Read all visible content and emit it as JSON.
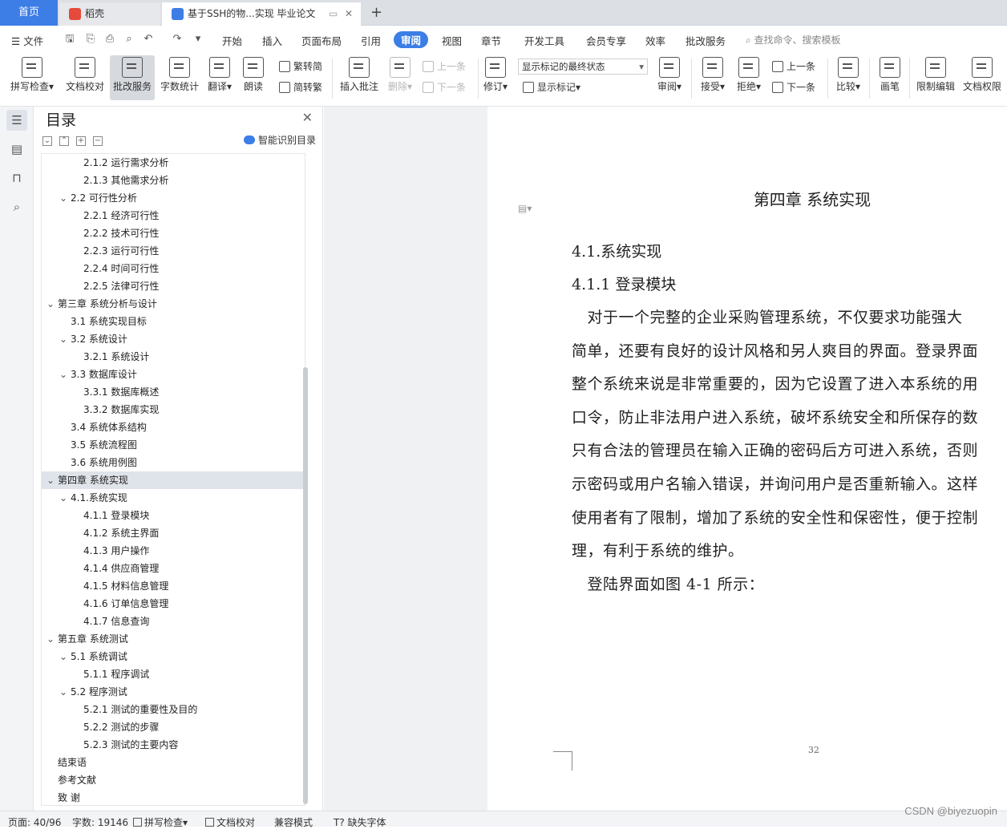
{
  "tabs": {
    "home": "首页",
    "docer": "稻壳",
    "doc": "基于SSH的物...实现 毕业论文",
    "add": "+"
  },
  "menu": {
    "file": "文件",
    "items": [
      "开始",
      "插入",
      "页面布局",
      "引用",
      "审阅",
      "视图",
      "章节",
      "开发工具",
      "会员专享",
      "效率",
      "批改服务"
    ],
    "active": "审阅",
    "search": "查找命令、搜索模板"
  },
  "ribbon": {
    "spell": "拼写检查",
    "proof": "文档校对",
    "correct": "批改服务",
    "wordcount": "字数统计",
    "translate": "翻译",
    "read": "朗读",
    "trad": "繁转简",
    "simp": "简转繁",
    "insert_comment": "插入批注",
    "delete": "删除",
    "prev": "上一条",
    "next": "下一条",
    "track": "修订",
    "markup_state": "显示标记的最终状态",
    "show_markup": "显示标记",
    "review": "审阅",
    "accept": "接受",
    "reject": "拒绝",
    "prev2": "上一条",
    "next2": "下一条",
    "compare": "比较",
    "pen": "画笔",
    "restrict": "限制编辑",
    "perm": "文档权限"
  },
  "nav": {
    "title": "目录",
    "smart": "智能识别目录",
    "toc": [
      {
        "text": "2.1.2 运行需求分析",
        "level": 3
      },
      {
        "text": "2.1.3 其他需求分析",
        "level": 3
      },
      {
        "text": "2.2 可行性分析",
        "level": 2,
        "arrow": true
      },
      {
        "text": "2.2.1 经济可行性",
        "level": 3
      },
      {
        "text": "2.2.2 技术可行性",
        "level": 3
      },
      {
        "text": "2.2.3  运行可行性",
        "level": 3
      },
      {
        "text": "2.2.4 时间可行性",
        "level": 3
      },
      {
        "text": "2.2.5  法律可行性",
        "level": 3
      },
      {
        "text": "第三章  系统分析与设计",
        "level": 1,
        "arrow": true
      },
      {
        "text": "3.1 系统实现目标",
        "level": 2
      },
      {
        "text": "3.2  系统设计",
        "level": 2,
        "arrow": true
      },
      {
        "text": "3.2.1 系统设计",
        "level": 3
      },
      {
        "text": "3.3 数据库设计",
        "level": 2,
        "arrow": true
      },
      {
        "text": "3.3.1 数据库概述",
        "level": 3
      },
      {
        "text": "3.3.2 数据库实现",
        "level": 3
      },
      {
        "text": "3.4 系统体系结构",
        "level": 2
      },
      {
        "text": "3.5 系统流程图",
        "level": 2
      },
      {
        "text": "3.6 系统用例图",
        "level": 2
      },
      {
        "text": "第四章  系统实现",
        "level": 1,
        "arrow": true,
        "selected": true
      },
      {
        "text": "4.1.系统实现",
        "level": 2,
        "arrow": true
      },
      {
        "text": "4.1.1  登录模块",
        "level": 3
      },
      {
        "text": "4.1.2 系统主界面",
        "level": 3
      },
      {
        "text": "4.1.3 用户操作",
        "level": 3
      },
      {
        "text": "4.1.4 供应商管理",
        "level": 3
      },
      {
        "text": "4.1.5 材料信息管理",
        "level": 3
      },
      {
        "text": "4.1.6 订单信息管理",
        "level": 3
      },
      {
        "text": "4.1.7 信息查询",
        "level": 3
      },
      {
        "text": "第五章    系统测试",
        "level": 1,
        "arrow": true
      },
      {
        "text": "5.1 系统调试",
        "level": 2,
        "arrow": true
      },
      {
        "text": "5.1.1  程序调试",
        "level": 3
      },
      {
        "text": "5.2  程序测试",
        "level": 2,
        "arrow": true
      },
      {
        "text": "5.2.1  测试的重要性及目的",
        "level": 3
      },
      {
        "text": "5.2.2  测试的步骤",
        "level": 3
      },
      {
        "text": "5.2.3  测试的主要内容",
        "level": 3
      },
      {
        "text": "结束语",
        "level": 1
      },
      {
        "text": "参考文献",
        "level": 1
      },
      {
        "text": "致    谢",
        "level": 1
      }
    ]
  },
  "doc": {
    "chapter": "第四章  系统实现",
    "h2a": "4.1.系统实现",
    "h2b": "4.1.1  登录模块",
    "lines": [
      "　对于一个完整的企业采购管理系统，不仅要求功能强大",
      "简单，还要有良好的设计风格和另人爽目的界面。登录界面",
      "整个系统来说是非常重要的，因为它设置了进入本系统的用",
      "口令，防止非法用户进入系统，破坏系统安全和所保存的数",
      "只有合法的管理员在输入正确的密码后方可进入系统，否则",
      "示密码或用户名输入错误，并询问用户是否重新输入。这样",
      "使用者有了限制，增加了系统的安全性和保密性，便于控制",
      "理，有利于系统的维护。",
      "　登陆界面如图 4-1 所示："
    ],
    "page_number": "32"
  },
  "status": {
    "page": "页面: 40/96",
    "words": "字数: 19146",
    "spell": "拼写检查",
    "proof": "文档校对",
    "compat": "兼容模式",
    "missing_font": "缺失字体"
  },
  "watermark": "CSDN @biyezuopin"
}
